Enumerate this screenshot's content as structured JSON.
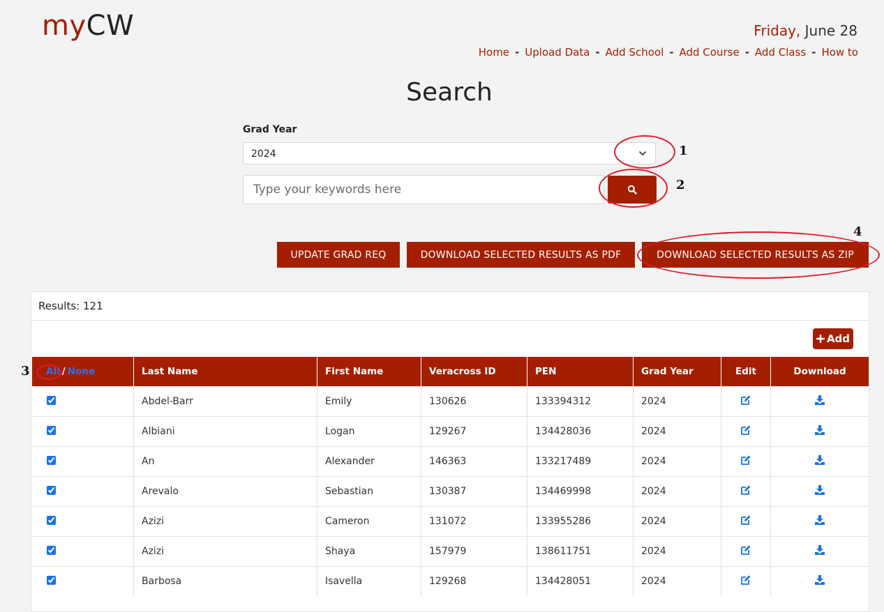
{
  "brand": {
    "prefix": "my",
    "suffix": "CW"
  },
  "date": {
    "day": "Friday,",
    "rest": " June 28"
  },
  "nav": {
    "items": [
      "Home",
      "Upload Data",
      "Add School",
      "Add Course",
      "Add Class",
      "How to"
    ],
    "separator": "-"
  },
  "page_title": "Search",
  "grad_year": {
    "label": "Grad Year",
    "selected": "2024"
  },
  "search": {
    "placeholder": "Type your keywords here"
  },
  "actions": {
    "update_grad_req": "UPDATE GRAD REQ",
    "download_pdf": "DOWNLOAD SELECTED RESULTS AS PDF",
    "download_zip": "DOWNLOAD SELECTED RESULTS AS ZIP"
  },
  "annotations": [
    "1",
    "2",
    "3",
    "4"
  ],
  "results": {
    "label": "Results: 121",
    "add_label": "Add",
    "select_all": "All",
    "select_sep": "/",
    "select_none": "None",
    "columns": [
      "Last Name",
      "First Name",
      "Veracross ID",
      "PEN",
      "Grad Year",
      "Edit",
      "Download"
    ],
    "rows": [
      {
        "checked": true,
        "last": "Abdel-Barr",
        "first": "Emily",
        "vid": "130626",
        "pen": "133394312",
        "year": "2024"
      },
      {
        "checked": true,
        "last": "Albiani",
        "first": "Logan",
        "vid": "129267",
        "pen": "134428036",
        "year": "2024"
      },
      {
        "checked": true,
        "last": "An",
        "first": "Alexander",
        "vid": "146363",
        "pen": "133217489",
        "year": "2024"
      },
      {
        "checked": true,
        "last": "Arevalo",
        "first": "Sebastian",
        "vid": "130387",
        "pen": "134469998",
        "year": "2024"
      },
      {
        "checked": true,
        "last": "Azizi",
        "first": "Cameron",
        "vid": "131072",
        "pen": "133955286",
        "year": "2024"
      },
      {
        "checked": true,
        "last": "Azizi",
        "first": "Shaya",
        "vid": "157979",
        "pen": "138611751",
        "year": "2024"
      },
      {
        "checked": true,
        "last": "Barbosa",
        "first": "Isavella",
        "vid": "129268",
        "pen": "134428051",
        "year": "2024"
      }
    ]
  },
  "colors": {
    "brand": "#a31f00",
    "link": "#2f6fe8",
    "annotation": "#e21b2b"
  }
}
